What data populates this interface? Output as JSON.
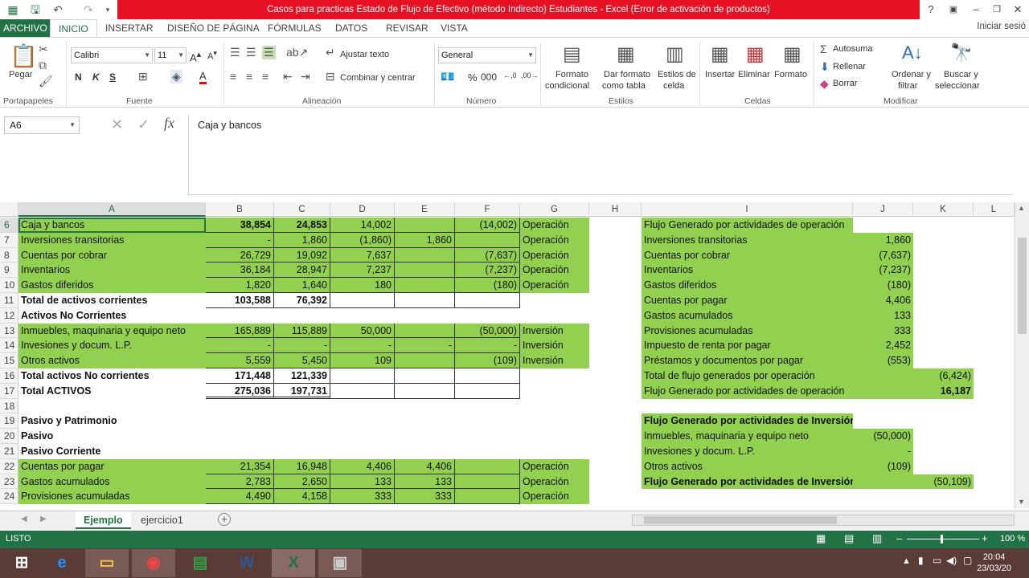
{
  "window": {
    "title": "Casos para practicas Estado de Flujo de Efectivo (método Indirecto) Estudiantes -  Excel (Error de activación de productos)",
    "signin": "Iniciar sesió"
  },
  "tabs": [
    "ARCHIVO",
    "INICIO",
    "INSERTAR",
    "DISEÑO DE PÁGINA",
    "FÓRMULAS",
    "DATOS",
    "REVISAR",
    "VISTA"
  ],
  "ribbon": {
    "portapapeles": {
      "paste": "Pegar",
      "label": "Portapapeles"
    },
    "fuente": {
      "font": "Calibri",
      "size": "11",
      "bold": "N",
      "italic": "K",
      "underline": "S",
      "label": "Fuente"
    },
    "alineacion": {
      "wrap": "Ajustar texto",
      "merge": "Combinar y centrar",
      "label": "Alineación"
    },
    "numero": {
      "format": "General",
      "label": "Número"
    },
    "estilos": {
      "cond1": "Formato",
      "cond2": "condicional",
      "table1": "Dar formato",
      "table2": "como tabla",
      "cell1": "Estilos de",
      "cell2": "celda",
      "label": "Estilos"
    },
    "celdas": {
      "insert": "Insertar",
      "delete": "Eliminar",
      "format": "Formato",
      "label": "Celdas"
    },
    "modificar": {
      "autosum": "Autosuma",
      "fill": "Rellenar",
      "clear": "Borrar",
      "sort1": "Ordenar y",
      "sort2": "filtrar",
      "find1": "Buscar y",
      "find2": "seleccionar",
      "label": "Modificar"
    }
  },
  "formula": {
    "namebox": "A6",
    "fx": "fx",
    "content": "Caja y bancos"
  },
  "columns": [
    "A",
    "B",
    "C",
    "D",
    "E",
    "F",
    "G",
    "H",
    "I",
    "J",
    "K",
    "L"
  ],
  "rows": [
    {
      "n": "6",
      "A": "Caja y bancos",
      "B": "38,854",
      "C": "24,853",
      "D": "14,002",
      "E": "",
      "F": "(14,002)",
      "G": "Operación",
      "I": "Flujo Generado por actividades de operación",
      "J": "",
      "K": ""
    },
    {
      "n": "7",
      "A": "Inversiones transitorias",
      "B": "-",
      "C": "1,860",
      "D": "(1,860)",
      "E": "1,860",
      "F": "",
      "G": "Operación",
      "I": "Inversiones transitorias",
      "J": "1,860",
      "K": ""
    },
    {
      "n": "8",
      "A": "Cuentas por cobrar",
      "B": "26,729",
      "C": "19,092",
      "D": "7,637",
      "E": "",
      "F": "(7,637)",
      "G": "Operación",
      "I": "Cuentas por cobrar",
      "J": "(7,637)",
      "K": ""
    },
    {
      "n": "9",
      "A": "Inventarios",
      "B": "36,184",
      "C": "28,947",
      "D": "7,237",
      "E": "",
      "F": "(7,237)",
      "G": "Operación",
      "I": "Inventarios",
      "J": "(7,237)",
      "K": ""
    },
    {
      "n": "10",
      "A": "Gastos diferidos",
      "B": "1,820",
      "C": "1,640",
      "D": "180",
      "E": "",
      "F": "(180)",
      "G": "Operación",
      "I": "Gastos diferidos",
      "J": "(180)",
      "K": ""
    },
    {
      "n": "11",
      "A": "Total de activos corrientes",
      "B": "103,588",
      "C": "76,392",
      "D": "",
      "E": "",
      "F": "",
      "G": "",
      "I": "Cuentas por pagar",
      "J": "4,406",
      "K": ""
    },
    {
      "n": "12",
      "A": "Activos No Corrientes",
      "B": "",
      "C": "",
      "D": "",
      "E": "",
      "F": "",
      "G": "",
      "I": "Gastos acumulados",
      "J": "133",
      "K": ""
    },
    {
      "n": "13",
      "A": "Inmuebles, maquinaria y equipo neto",
      "B": "165,889",
      "C": "115,889",
      "D": "50,000",
      "E": "",
      "F": "(50,000)",
      "G": "Inversión",
      "I": "Provisiones acumuladas",
      "J": "333",
      "K": ""
    },
    {
      "n": "14",
      "A": "Invesiones y docum. L.P.",
      "B": "-",
      "C": "-",
      "D": "-",
      "E": "-",
      "F": "-",
      "G": "Inversión",
      "I": "Impuesto de renta por pagar",
      "J": "2,452",
      "K": ""
    },
    {
      "n": "15",
      "A": "Otros activos",
      "B": "5,559",
      "C": "5,450",
      "D": "109",
      "E": "",
      "F": "(109)",
      "G": "Inversión",
      "I": "Préstamos y documentos por pagar",
      "J": "(553)",
      "K": ""
    },
    {
      "n": "16",
      "A": "Total activos No corrientes",
      "B": "171,448",
      "C": "121,339",
      "D": "",
      "E": "",
      "F": "",
      "G": "",
      "I": "Total de flujo generados por operación",
      "J": "",
      "K": "(6,424)"
    },
    {
      "n": "17",
      "A": "Total ACTIVOS",
      "B": "275,036",
      "C": "197,731",
      "D": "",
      "E": "",
      "F": "",
      "G": "",
      "I": "Flujo Generado por actividades de operación",
      "J": "",
      "K": "16,187"
    },
    {
      "n": "18",
      "A": "",
      "B": "",
      "C": "",
      "D": "",
      "E": "",
      "F": "",
      "G": "",
      "I": "",
      "J": "",
      "K": ""
    },
    {
      "n": "19",
      "A": "Pasivo y Patrimonio",
      "B": "",
      "C": "",
      "D": "",
      "E": "",
      "F": "",
      "G": "",
      "I": "Flujo Generado por actividades de Inversión",
      "J": "",
      "K": ""
    },
    {
      "n": "20",
      "A": "Pasivo",
      "B": "",
      "C": "",
      "D": "",
      "E": "",
      "F": "",
      "G": "",
      "I": "Inmuebles, maquinaria y equipo neto",
      "J": "(50,000)",
      "K": ""
    },
    {
      "n": "21",
      "A": "Pasivo Corriente",
      "B": "",
      "C": "",
      "D": "",
      "E": "",
      "F": "",
      "G": "",
      "I": "Invesiones y docum. L.P.",
      "J": "-",
      "K": ""
    },
    {
      "n": "22",
      "A": "Cuentas por pagar",
      "B": "21,354",
      "C": "16,948",
      "D": "4,406",
      "E": "4,406",
      "F": "",
      "G": "Operación",
      "I": "Otros activos",
      "J": "(109)",
      "K": ""
    },
    {
      "n": "23",
      "A": "Gastos acumulados",
      "B": "2,783",
      "C": "2,650",
      "D": "133",
      "E": "133",
      "F": "",
      "G": "Operación",
      "I": "Flujo Generado por actividades de Inversión",
      "J": "",
      "K": "(50,109)"
    },
    {
      "n": "24",
      "A": "Provisiones acumuladas",
      "B": "4,490",
      "C": "4,158",
      "D": "333",
      "E": "333",
      "F": "",
      "G": "Operación",
      "I": "",
      "J": "",
      "K": ""
    }
  ],
  "sheets": [
    "Ejemplo",
    "ejercicio1"
  ],
  "status": {
    "ready": "LISTO",
    "zoom": "100 %"
  },
  "clock": {
    "time": "20:04",
    "date": "23/03/20"
  }
}
